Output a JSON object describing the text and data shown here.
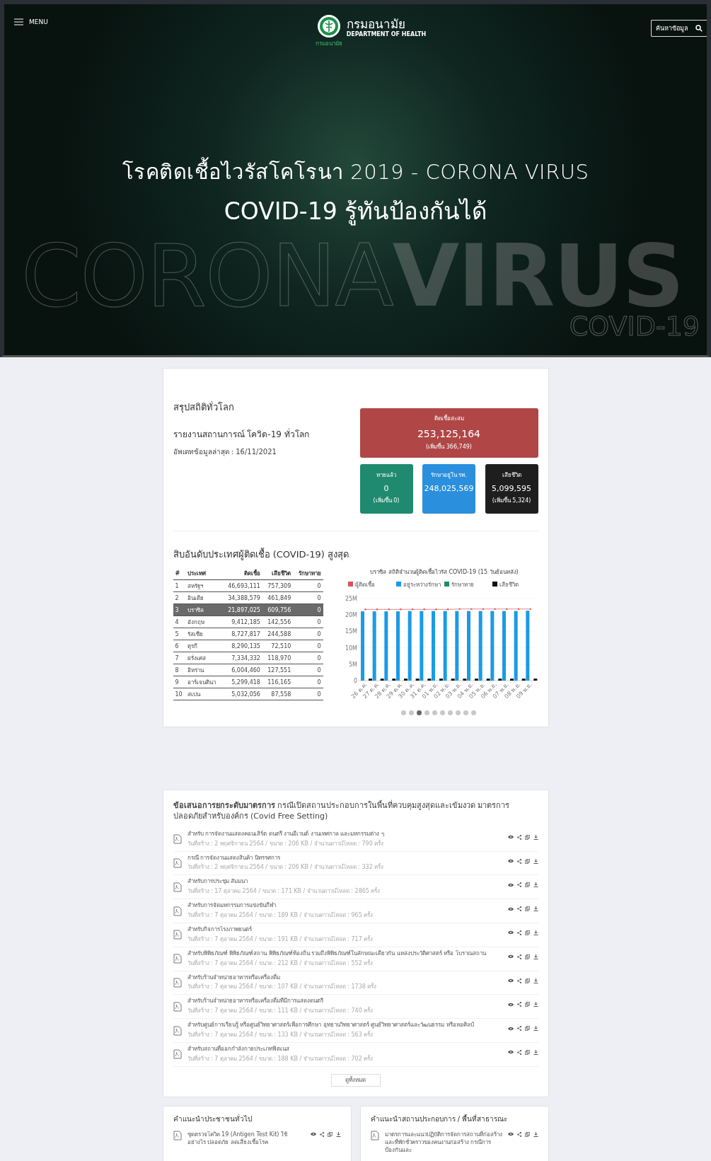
{
  "header": {
    "menu_label": "MENU",
    "logo_title": "กรมอนามัย",
    "logo_subtitle": "DEPARTMENT OF HEALTH",
    "logo_caption": "กรมอนามัย",
    "search_label": "ค้นหาข้อมูล"
  },
  "hero": {
    "title": "โรคติดเชื้อไวรัสโคโรนา 2019 - CORONA VIRUS",
    "subtitle": "COVID-19 รู้ทันป้องกันได้",
    "backdrop_light": "CORONA",
    "backdrop_bold": "VIRUS",
    "backdrop_small": "COVID-19"
  },
  "world_stats": {
    "heading": "สรุปสถิติทั่วโลก",
    "report_title": "รายงานสถานการณ์ โควิด-19 ทั่วโลก",
    "updated": "อัพเดทข้อมูลล่าสุด : 16/11/2021",
    "total": {
      "label": "ติดเชื้อสะสม",
      "value": "253,125,164",
      "change": "(เพิ่มขึ้น 366,749)",
      "color": "#b04646"
    },
    "boxes": [
      {
        "label": "หายแล้ว",
        "value": "0",
        "change": "(เพิ่มขึ้น 0)",
        "color": "#1f8a70"
      },
      {
        "label": "รักษาอยู่ใน รพ.",
        "value": "248,025,569",
        "color": "#2a8fdc"
      },
      {
        "label": "เสียชีวิต",
        "value": "5,099,595",
        "change": "(เพิ่มขึ้น 5,324)",
        "color": "#1e1e1e"
      }
    ]
  },
  "top_countries": {
    "heading": "สิบอันดับประเทศผู้ติดเชื้อ (COVID-19) สูงสุด",
    "columns": [
      "#",
      "ประเทศ",
      "ติดเชื้อ",
      "เสียชีวิต",
      "รักษาหาย"
    ],
    "rows": [
      {
        "cells": [
          "1",
          "สหรัฐฯ",
          "46,693,111",
          "757,309",
          "0"
        ],
        "selected": false
      },
      {
        "cells": [
          "2",
          "อินเดีย",
          "34,388,579",
          "461,849",
          "0"
        ],
        "selected": false
      },
      {
        "cells": [
          "3",
          "บราซิล",
          "21,897,025",
          "609,756",
          "0"
        ],
        "selected": true
      },
      {
        "cells": [
          "4",
          "อังกฤษ",
          "9,412,185",
          "142,556",
          "0"
        ],
        "selected": false
      },
      {
        "cells": [
          "5",
          "รัสเซีย",
          "8,727,817",
          "244,588",
          "0"
        ],
        "selected": false
      },
      {
        "cells": [
          "6",
          "ตุรกี",
          "8,290,135",
          "72,510",
          "0"
        ],
        "selected": false
      },
      {
        "cells": [
          "7",
          "ฝรั่งเศส",
          "7,334,332",
          "118,970",
          "0"
        ],
        "selected": false
      },
      {
        "cells": [
          "8",
          "อิหร่าน",
          "6,004,460",
          "127,551",
          "0"
        ],
        "selected": false
      },
      {
        "cells": [
          "9",
          "อาร์เจนตินา",
          "5,299,418",
          "116,165",
          "0"
        ],
        "selected": false
      },
      {
        "cells": [
          "10",
          "สเปน",
          "5,032,056",
          "87,558",
          "0"
        ],
        "selected": false
      }
    ],
    "chart_data": {
      "type": "bar",
      "title": "บราซิล สถิติจำนวนผู้ติดเชื้อไวรัส COVID-19 (15 วันย้อนหลัง)",
      "categories": [
        "26 ต.ค.",
        "27 ต.ค.",
        "28 ต.ค.",
        "29 ต.ค.",
        "30 ต.ค.",
        "31 ต.ค.",
        "01 พ.ย.",
        "02 พ.ย.",
        "03 พ.ย.",
        "04 พ.ย.",
        "05 พ.ย.",
        "06 พ.ย.",
        "07 พ.ย.",
        "08 พ.ย.",
        "09 พ.ย."
      ],
      "series": [
        {
          "name": "ผู้ติดเชื้อ",
          "color": "#e05252",
          "type": "line",
          "values": [
            21.7,
            21.7,
            21.7,
            21.7,
            21.7,
            21.7,
            21.7,
            21.7,
            21.8,
            21.8,
            21.8,
            21.8,
            21.8,
            21.8,
            21.8
          ]
        },
        {
          "name": "อยู่ระหว่างรักษา",
          "color": "#1a9be6",
          "values": [
            21.1,
            21.1,
            21.1,
            21.1,
            21.2,
            21.2,
            21.2,
            21.2,
            21.2,
            21.2,
            21.2,
            21.2,
            21.2,
            21.2,
            21.3
          ]
        },
        {
          "name": "รักษาหาย",
          "color": "#1f8a70",
          "values": [
            0,
            0,
            0,
            0,
            0,
            0,
            0,
            0,
            0,
            0,
            0,
            0,
            0,
            0,
            0
          ]
        },
        {
          "name": "เสียชีวิต",
          "color": "#111111",
          "values": [
            0.6,
            0.6,
            0.6,
            0.6,
            0.6,
            0.6,
            0.6,
            0.6,
            0.6,
            0.6,
            0.6,
            0.6,
            0.6,
            0.6,
            0.6
          ]
        }
      ],
      "grid": true,
      "legend": "top",
      "ylim": [
        0,
        25
      ],
      "yticks": [
        {
          "value": 0,
          "label": "0"
        },
        {
          "value": 5,
          "label": "5M"
        },
        {
          "value": 10,
          "label": "10M"
        },
        {
          "value": 15,
          "label": "15M"
        },
        {
          "value": 20,
          "label": "20M"
        },
        {
          "value": 25,
          "label": "25M"
        }
      ]
    },
    "pager": [
      {
        "selected": false
      },
      {
        "selected": false
      },
      {
        "selected": true
      },
      {
        "selected": false
      },
      {
        "selected": false
      },
      {
        "selected": false
      },
      {
        "selected": false
      },
      {
        "selected": false
      },
      {
        "selected": false
      },
      {
        "selected": false
      }
    ]
  },
  "measures": {
    "heading": "**ข้อเสนอการยกระดับมาตรการ** กรณีเปิดสถานประกอบการในพื้นที่ควบคุมสูงสุดและเข้มงวด มาตรการปลอดภัยสำหรับองค์กร (Covid Free Setting)",
    "documents": [
      {
        "title": "สำหรับ การจัดงานแสดงคอนเสิร์ต ดนตรี งานอีเวนต์ งานเทศกาล และมหกรรมต่าง ๆ",
        "meta": "วันที่สร้าง : 2 พฤศจิกายน 2564 / ขนาด : 206 KB / จำนวนดาวน์โหลด : 790 ครั้ง"
      },
      {
        "title": "กรณี การจัดงานแสดงสินค้า นิทรรศการ",
        "meta": "วันที่สร้าง : 2 พฤศจิกายน 2564 / ขนาด : 206 KB / จำนวนดาวน์โหลด : 332 ครั้ง"
      },
      {
        "title": "สำหรับการประชุม สัมมนา",
        "meta": "วันที่สร้าง : 17 ตุลาคม 2564 / ขนาด : 171 KB / จำนวนดาวน์โหลด : 2865 ครั้ง"
      },
      {
        "title": "สำหรับการจัดมหกรรมการแข่งขันกีฬา",
        "meta": "วันที่สร้าง : 7 ตุลาคม 2564 / ขนาด : 189 KB / จำนวนดาวน์โหลด : 965 ครั้ง"
      },
      {
        "title": "สำหรับกิจการโรงภาพยนตร์",
        "meta": "วันที่สร้าง : 7 ตุลาคม 2564 / ขนาด : 191 KB / จำนวนดาวน์โหลด : 717 ครั้ง"
      },
      {
        "title": "สำหรับพิพิธภัณฑ์ พิพิธภัณฑ์สถาน พิพิธภัณฑ์ท้องถิ่น รวมถึงพิพิธภัณฑ์ในลักษณะเดียวกัน แหล่งประวัติศาสตร์ หรือ โบราณสถาน",
        "meta": "วันที่สร้าง : 7 ตุลาคม 2564 / ขนาด : 212 KB / จำนวนดาวน์โหลด : 552 ครั้ง"
      },
      {
        "title": "สำหรับร้านจำหน่ายอาหารหรือเครื่องดื่ม",
        "meta": "วันที่สร้าง : 7 ตุลาคม 2564 / ขนาด : 107 KB / จำนวนดาวน์โหลด : 1738 ครั้ง"
      },
      {
        "title": "สำหรับร้านจำหน่ายอาหารหรือเครื่องดื่มที่มีการแสดงดนตรี",
        "meta": "วันที่สร้าง : 7 ตุลาคม 2564 / ขนาด : 111 KB / จำนวนดาวน์โหลด : 740 ครั้ง"
      },
      {
        "title": "สำหรับศูนย์การเรียนรู้ หรือศูนย์วิทยาศาสตร์เพื่อการศึกษา อุทยานวิทยาศาสตร์ ศูนย์วิทยาศาสตร์และวัฒนธรรม หรือหอศิลป์",
        "meta": "วันที่สร้าง : 7 ตุลาคม 2564 / ขนาด : 133 KB / จำนวนดาวน์โหลด : 563 ครั้ง"
      },
      {
        "title": "สำหรับสถานที่ออกกำลังกายประเภทฟิตเนส",
        "meta": "วันที่สร้าง : 7 ตุลาคม 2564 / ขนาด : 188 KB / จำนวนดาวน์โหลด : 702 ครั้ง"
      }
    ],
    "view_all": "ดูทั้งหมด"
  },
  "advice": [
    {
      "heading": "คำแนะนำประชาชนทั่วไป",
      "documents": [
        {
          "title": "ชุดตรวจโควิด 19 (Antigen Test Kit) ใช้อย่างไร ปลอดภัย ลดเสี่ยงเชื้อโรค"
        }
      ]
    },
    {
      "heading": "คำแนะนำสถานประกอบการ / พื้นที่สาธารณะ",
      "documents": [
        {
          "title": "มาตรการและแนวปฏิบัติการจัดการสถานที่ก่อสร้างและที่พักชั่วคราวของคนงานก่อสร้าง กรณีการป้องกันและ"
        }
      ]
    }
  ]
}
